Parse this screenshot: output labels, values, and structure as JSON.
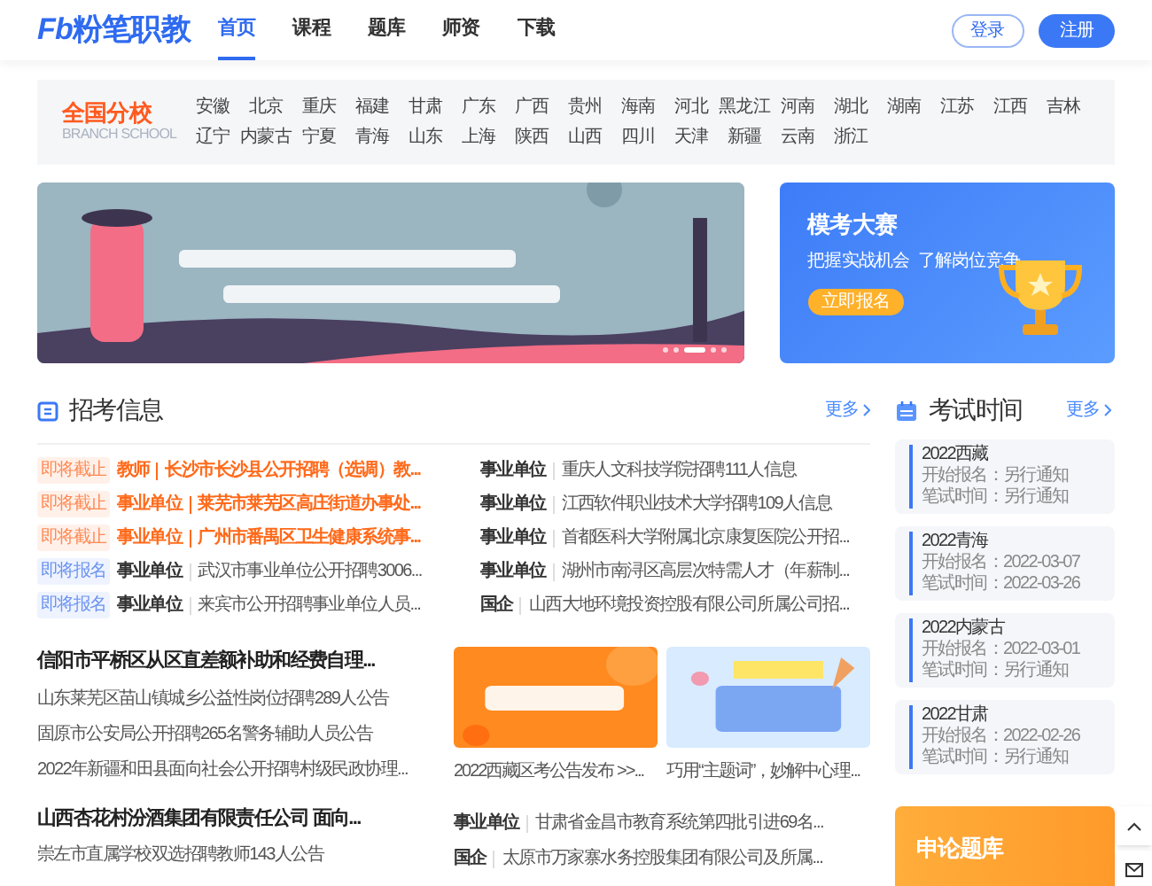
{
  "header": {
    "logo_mark": "Fb",
    "logo_text": "粉笔职教",
    "nav": [
      {
        "label": "首页",
        "selected": true
      },
      {
        "label": "课程",
        "selected": false
      },
      {
        "label": "题库",
        "selected": false
      },
      {
        "label": "师资",
        "selected": false
      },
      {
        "label": "下载",
        "selected": false
      }
    ],
    "login": "登录",
    "register": "注册"
  },
  "branches": {
    "title": "全国分校",
    "subtitle": "BRANCH SCHOOL",
    "provinces": [
      "安徽",
      "北京",
      "重庆",
      "福建",
      "甘肃",
      "广东",
      "广西",
      "贵州",
      "海南",
      "河北",
      "黑龙江",
      "河南",
      "湖北",
      "湖南",
      "江苏",
      "江西",
      "吉林",
      "辽宁",
      "内蒙古",
      "宁夏",
      "青海",
      "山东",
      "上海",
      "陕西",
      "山西",
      "四川",
      "天津",
      "新疆",
      "云南",
      "浙江"
    ]
  },
  "banner": {
    "dots": [
      {
        "selected": false
      },
      {
        "selected": false
      },
      {
        "selected": true
      },
      {
        "selected": false
      },
      {
        "selected": false
      }
    ]
  },
  "promo": {
    "title": "模考大赛",
    "subtitle": "把握实战机会  了解岗位竞争",
    "button": "立即报名"
  },
  "recruit": {
    "title": "招考信息",
    "more": "更多",
    "left": [
      {
        "tag": "即将截止",
        "kind": "closing",
        "category": "教师",
        "text": "长沙市长沙县公开招聘（选调）教..."
      },
      {
        "tag": "即将截止",
        "kind": "closing",
        "category": "事业单位",
        "text": "莱芜市莱芜区高庄街道办事处..."
      },
      {
        "tag": "即将截止",
        "kind": "closing",
        "category": "事业单位",
        "text": "广州市番禺区卫生健康系统事..."
      },
      {
        "tag": "即将报名",
        "kind": "upcoming",
        "category": "事业单位",
        "text": "武汉市事业单位公开招聘3006..."
      },
      {
        "tag": "即将报名",
        "kind": "upcoming",
        "category": "事业单位",
        "text": "来宾市公开招聘事业单位人员..."
      }
    ],
    "right": [
      {
        "category": "事业单位",
        "text": "重庆人文科技学院招聘111人信息"
      },
      {
        "category": "事业单位",
        "text": "江西软件职业技术大学招聘109人信息"
      },
      {
        "category": "事业单位",
        "text": "首都医科大学附属北京康复医院公开招..."
      },
      {
        "category": "事业单位",
        "text": "湖州市南浔区高层次特需人才（年薪制..."
      },
      {
        "category": "国企",
        "text": "山西大地环境投资控股有限公司所属公司招..."
      }
    ]
  },
  "exams": {
    "title": "考试时间",
    "more": "更多",
    "items": [
      {
        "name": "2022西藏",
        "start": "开始报名：另行通知",
        "written": "笔试时间：另行通知"
      },
      {
        "name": "2022青海",
        "start": "开始报名：2022-03-07",
        "written": "笔试时间：2022-03-26"
      },
      {
        "name": "2022内蒙古",
        "start": "开始报名：2022-03-01",
        "written": "笔试时间：另行通知"
      },
      {
        "name": "2022甘肃",
        "start": "开始报名：2022-02-26",
        "written": "笔试时间：另行通知"
      }
    ]
  },
  "news": [
    {
      "headline": "信阳市平桥区从区直差额补助和经费自理...",
      "lines": [
        "山东莱芜区苗山镇城乡公益性岗位招聘289人公告",
        "固原市公安局公开招聘265名警务辅助人员公告",
        "2022年新疆和田县面向社会公开招聘村级民政协理..."
      ]
    },
    {
      "headline": "山西杏花村汾酒集团有限责任公司 面向...",
      "lines": [
        "崇左市直属学校双选招聘教师143人公告"
      ]
    }
  ],
  "thumbs": [
    {
      "kind": "picture",
      "caption": "2022西藏区考公告发布 >>..."
    },
    {
      "kind": "picture",
      "caption": "巧用“主题词”，妙解中心理..."
    }
  ],
  "more_jobs": [
    {
      "category": "事业单位",
      "text": "甘肃省金昌市教育系统第四批引进69名..."
    },
    {
      "category": "国企",
      "text": "太原市万家寨水务控股集团有限公司及所属..."
    }
  ],
  "side_card": {
    "title": "申论题库"
  }
}
